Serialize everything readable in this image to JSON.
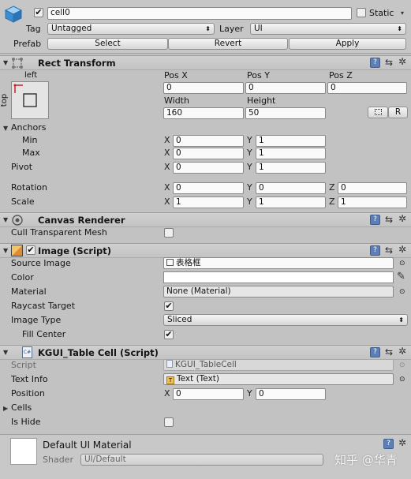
{
  "header": {
    "name": "cell0",
    "static_label": "Static",
    "tag_label": "Tag",
    "tag_value": "Untagged",
    "layer_label": "Layer",
    "layer_value": "UI",
    "prefab_label": "Prefab",
    "select": "Select",
    "revert": "Revert",
    "apply": "Apply"
  },
  "rect_transform": {
    "title": "Rect Transform",
    "anchor_preset_top_label": "left",
    "anchor_preset_side_label": "top",
    "pos_x_label": "Pos X",
    "pos_y_label": "Pos Y",
    "pos_z_label": "Pos Z",
    "pos_x": "0",
    "pos_y": "0",
    "pos_z": "0",
    "width_label": "Width",
    "height_label": "Height",
    "width": "160",
    "height": "50",
    "raw_edit_button": "R",
    "anchors_label": "Anchors",
    "min_label": "Min",
    "max_label": "Max",
    "pivot_label": "Pivot",
    "x": "X",
    "y": "Y",
    "z": "Z",
    "anchor_min_x": "0",
    "anchor_min_y": "1",
    "anchor_max_x": "0",
    "anchor_max_y": "1",
    "pivot_x": "0",
    "pivot_y": "1",
    "rotation_label": "Rotation",
    "rotation_x": "0",
    "rotation_y": "0",
    "rotation_z": "0",
    "scale_label": "Scale",
    "scale_x": "1",
    "scale_y": "1",
    "scale_z": "1"
  },
  "canvas_renderer": {
    "title": "Canvas Renderer",
    "cull_label": "Cull Transparent Mesh"
  },
  "image": {
    "title": "Image (Script)",
    "source_image_label": "Source Image",
    "source_image": "表格框",
    "color_label": "Color",
    "color_value": "#ffffff",
    "material_label": "Material",
    "material": "None (Material)",
    "raycast_label": "Raycast Target",
    "image_type_label": "Image Type",
    "image_type": "Sliced",
    "fill_center_label": "Fill Center"
  },
  "table_cell": {
    "title": "KGUI_Table Cell (Script)",
    "script_label": "Script",
    "script": "KGUI_TableCell",
    "text_info_label": "Text Info",
    "text_info": "Text (Text)",
    "position_label": "Position",
    "position_x": "0",
    "position_y": "0",
    "cells_label": "Cells",
    "is_hide_label": "Is Hide"
  },
  "material": {
    "title": "Default UI Material",
    "shader_label": "Shader",
    "shader": "UI/Default"
  },
  "watermark": "知乎 @华青"
}
